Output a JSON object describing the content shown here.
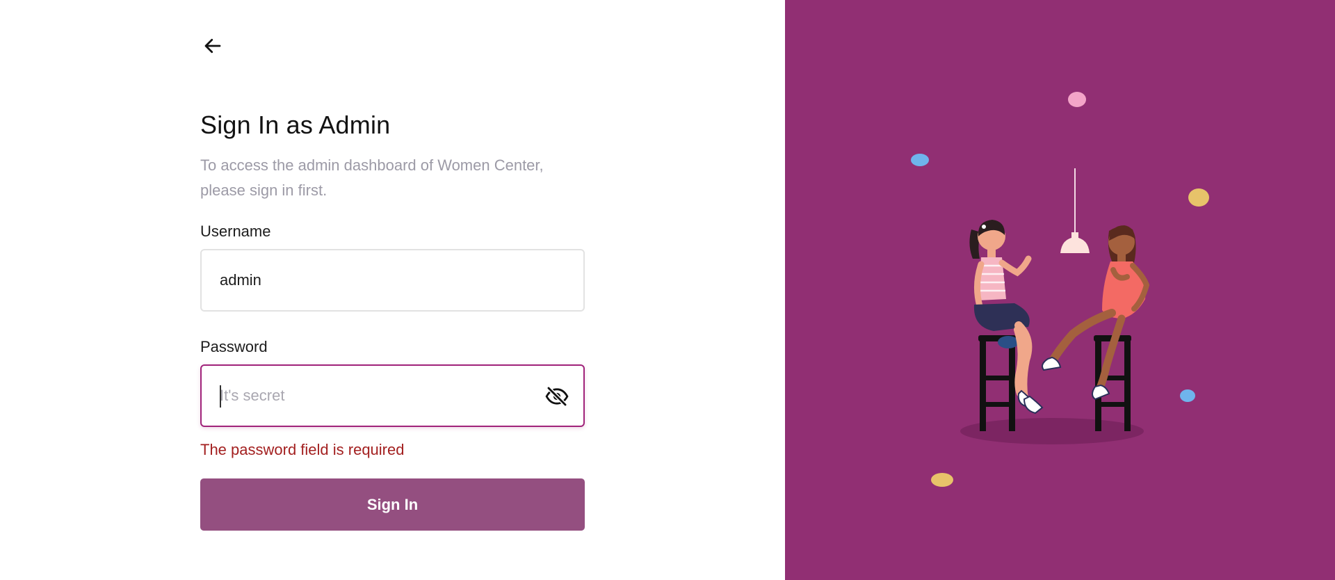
{
  "header": {
    "back_icon": "arrow-left-icon"
  },
  "form": {
    "title": "Sign In as Admin",
    "subtitle": "To access the admin dashboard of Women Center, please sign in first.",
    "username": {
      "label": "Username",
      "value": "admin"
    },
    "password": {
      "label": "Password",
      "value": "",
      "placeholder": "It's secret",
      "toggle_icon": "eye-slash-icon",
      "error": "The password field is required"
    },
    "submit_label": "Sign In"
  },
  "illustration": {
    "name": "two-women-on-bar-stools",
    "background_color": "#912f73"
  },
  "colors": {
    "brand": "#912f73",
    "button": "#944f80",
    "error_text": "#a32020",
    "error_border": "#a0237a",
    "muted_text": "#9c9aa6"
  }
}
